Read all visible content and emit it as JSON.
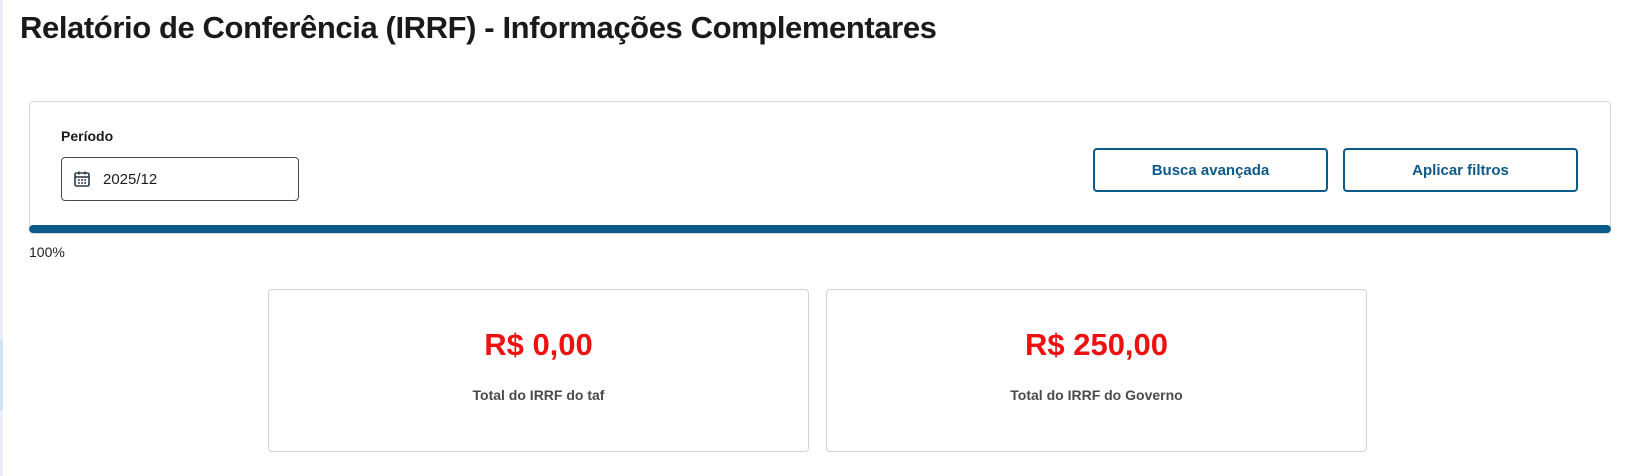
{
  "page": {
    "title": "Relatório de Conferência (IRRF) - Informações Complementares"
  },
  "filters": {
    "period_label": "Período",
    "period_value": "2025/12",
    "period_icon": "calendar-icon",
    "advanced_search_label": "Busca avançada",
    "apply_filters_label": "Aplicar filtros"
  },
  "progress": {
    "value_percent": 100,
    "label": "100%"
  },
  "cards": [
    {
      "amount": "R$ 0,00",
      "caption": "Total do IRRF do taf"
    },
    {
      "amount": "R$ 250,00",
      "caption": "Total do IRRF do Governo"
    }
  ],
  "colors": {
    "accent": "#0c5a8a",
    "amount": "#ee1111",
    "border": "#d6d6d6"
  }
}
